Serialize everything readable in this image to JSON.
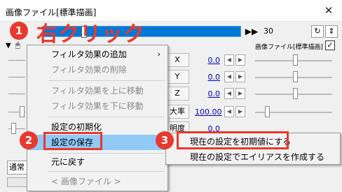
{
  "window": {
    "title": "画像ファイル[標準描画]",
    "close_glyph": "✕"
  },
  "toolbar": {
    "frame": "30",
    "skip_glyph": "▶▶",
    "obj_label": "画像ファイル[標準描画]"
  },
  "params": [
    {
      "name": "X",
      "value": "0.0"
    },
    {
      "name": "Y",
      "value": "0.0"
    },
    {
      "name": "Z",
      "value": "0.0"
    },
    {
      "name": "大率",
      "value": "100.00"
    },
    {
      "name": "明度",
      "value": "0.0"
    }
  ],
  "blend_mode": "通常",
  "context_menu": {
    "add_filter": "フィルタ効果の追加",
    "delete_filter": "フィルタ効果の削除",
    "move_up": "フィルタ効果を上に移動",
    "move_down": "フィルタ効果を下に移動",
    "reset": "設定の初期化",
    "save": "設定の保存",
    "undo": "元に戻す",
    "object_type": "< 画像ファイル >"
  },
  "submenu": {
    "set_default": "現在の設定を初期値にする",
    "create_alias": "現在の設定でエイリアスを作成する"
  },
  "annotations": {
    "step1": "1",
    "step2": "2",
    "step3": "3",
    "right_click_text": "右クリック",
    "accent_color": "#e8392e"
  }
}
